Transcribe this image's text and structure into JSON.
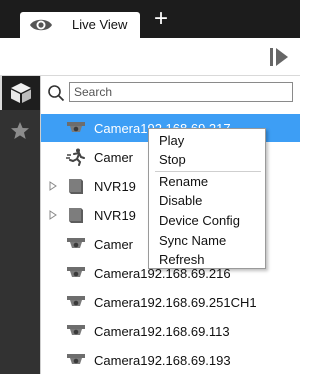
{
  "tabbar": {
    "tab_label": "Live View",
    "add_tab_symbol": "+"
  },
  "search": {
    "placeholder": "Search",
    "value": ""
  },
  "tree": {
    "items": [
      {
        "label": "Camera192.168.69.217",
        "icon": "dome-camera-icon",
        "selected": true
      },
      {
        "label": "Camer",
        "icon": "running-person-icon",
        "selected": false
      },
      {
        "label": "NVR19",
        "icon": "nvr-icon",
        "expandable": true
      },
      {
        "label": "NVR19",
        "icon": "nvr-icon",
        "expandable": true
      },
      {
        "label": "Camer",
        "icon": "dome-camera-icon"
      },
      {
        "label": "Camera192.168.69.216",
        "icon": "dome-camera-icon"
      },
      {
        "label": "Camera192.168.69.251CH1",
        "icon": "dome-camera-icon"
      },
      {
        "label": "Camera192.168.69.113",
        "icon": "dome-camera-icon"
      },
      {
        "label": "Camera192.168.69.193",
        "icon": "dome-camera-icon"
      }
    ]
  },
  "context_menu": {
    "items": [
      "Play",
      "Stop",
      "Rename",
      "Disable",
      "Device Config",
      "Sync Name",
      "Refresh"
    ]
  },
  "colors": {
    "tabbar_bg": "#1c1c1c",
    "rail_bg": "#323232",
    "selection": "#3d9ef5"
  }
}
